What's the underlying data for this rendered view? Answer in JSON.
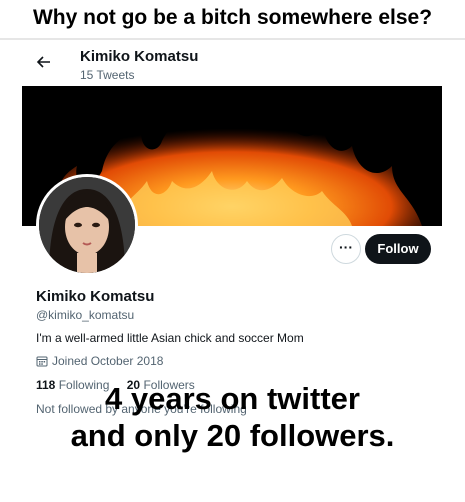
{
  "meme": {
    "top_text": "Why not go be a bitch somewhere else?",
    "bottom_line1": "4 years on twitter",
    "bottom_line2": "and only 20 followers."
  },
  "header": {
    "name": "Kimiko Komatsu",
    "tweets": "15 Tweets",
    "back_icon": "arrow-left-icon"
  },
  "banner": {
    "description_icon": "fire-image"
  },
  "profile": {
    "name": "Kimiko Komatsu",
    "handle": "@kimiko_komatsu",
    "bio": "I'm a well-armed little Asian chick and soccer Mom",
    "joined": "Joined October 2018",
    "following_count": "118",
    "following_label": "Following",
    "followers_count": "20",
    "followers_label": "Followers",
    "not_followed": "Not followed by anyone you’re following"
  },
  "actions": {
    "more_label": "···",
    "follow_label": "Follow"
  },
  "colors": {
    "text_primary": "#0f1419",
    "text_secondary": "#536471",
    "follow_bg": "#0f1419"
  }
}
